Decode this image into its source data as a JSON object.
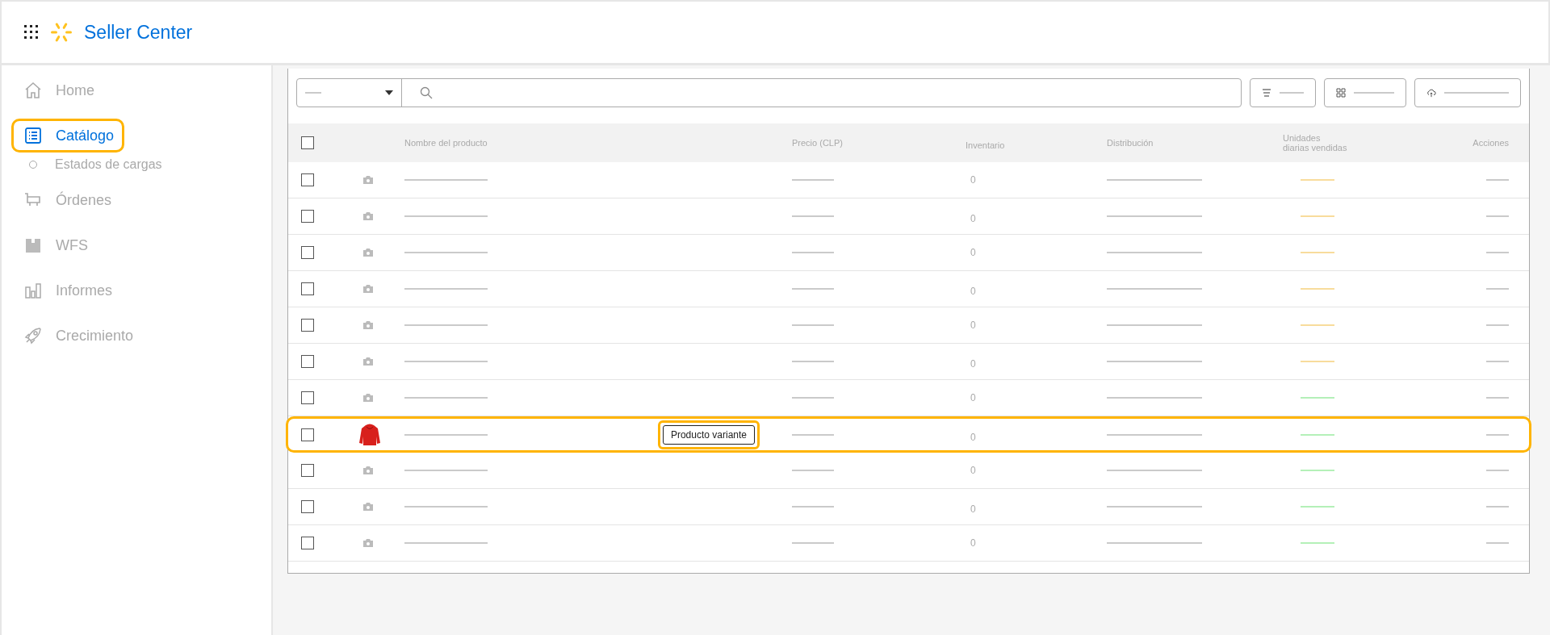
{
  "header": {
    "title": "Seller Center"
  },
  "sidebar": {
    "items": [
      {
        "label": "Home",
        "selected": false,
        "highlighted": false
      },
      {
        "label": "Catálogo",
        "selected": true,
        "highlighted": true,
        "children": [
          {
            "label": "Estados de cargas",
            "selected": false
          }
        ]
      },
      {
        "label": "Órdenes",
        "selected": false,
        "highlighted": false
      },
      {
        "label": "WFS",
        "selected": false,
        "highlighted": false
      },
      {
        "label": "Informes",
        "selected": false,
        "highlighted": false
      },
      {
        "label": "Crecimiento",
        "selected": false,
        "highlighted": false
      }
    ]
  },
  "table": {
    "header_checked": false,
    "columns": [
      "Nombre del producto",
      "Precio (CLP)",
      "Inventario",
      "Distribución",
      "Unidades diarias vendidas",
      "Acciones"
    ],
    "rows": [
      {
        "checked": false,
        "kind": "placeholder",
        "inventory": "0",
        "color": "#f8dc9c",
        "highlighted": false
      },
      {
        "checked": false,
        "kind": "placeholder",
        "inventory": "0",
        "color": "#f8dc9c",
        "highlighted": false
      },
      {
        "checked": false,
        "kind": "placeholder",
        "inventory": "0",
        "color": "#f8dc9c",
        "highlighted": false
      },
      {
        "checked": false,
        "kind": "placeholder",
        "inventory": "0",
        "color": "#f8dc9c",
        "highlighted": false
      },
      {
        "checked": false,
        "kind": "placeholder",
        "inventory": "0",
        "color": "#f8dc9c",
        "highlighted": false
      },
      {
        "checked": false,
        "kind": "placeholder",
        "inventory": "0",
        "color": "#f8dc9c",
        "highlighted": false
      },
      {
        "checked": false,
        "kind": "placeholder",
        "inventory": "0",
        "color": "#b4f0b8",
        "highlighted": false
      },
      {
        "checked": false,
        "kind": "photo",
        "inventory": "0",
        "color": "#b4f0b8",
        "highlighted": true,
        "tag": "Producto variante"
      },
      {
        "checked": false,
        "kind": "placeholder",
        "inventory": "0",
        "color": "#b4f0b8",
        "highlighted": false
      },
      {
        "checked": false,
        "kind": "placeholder",
        "inventory": "0",
        "color": "#b4f0b8",
        "highlighted": false
      },
      {
        "checked": false,
        "kind": "placeholder",
        "inventory": "0",
        "color": "#b4f0b8",
        "highlighted": false
      }
    ]
  }
}
